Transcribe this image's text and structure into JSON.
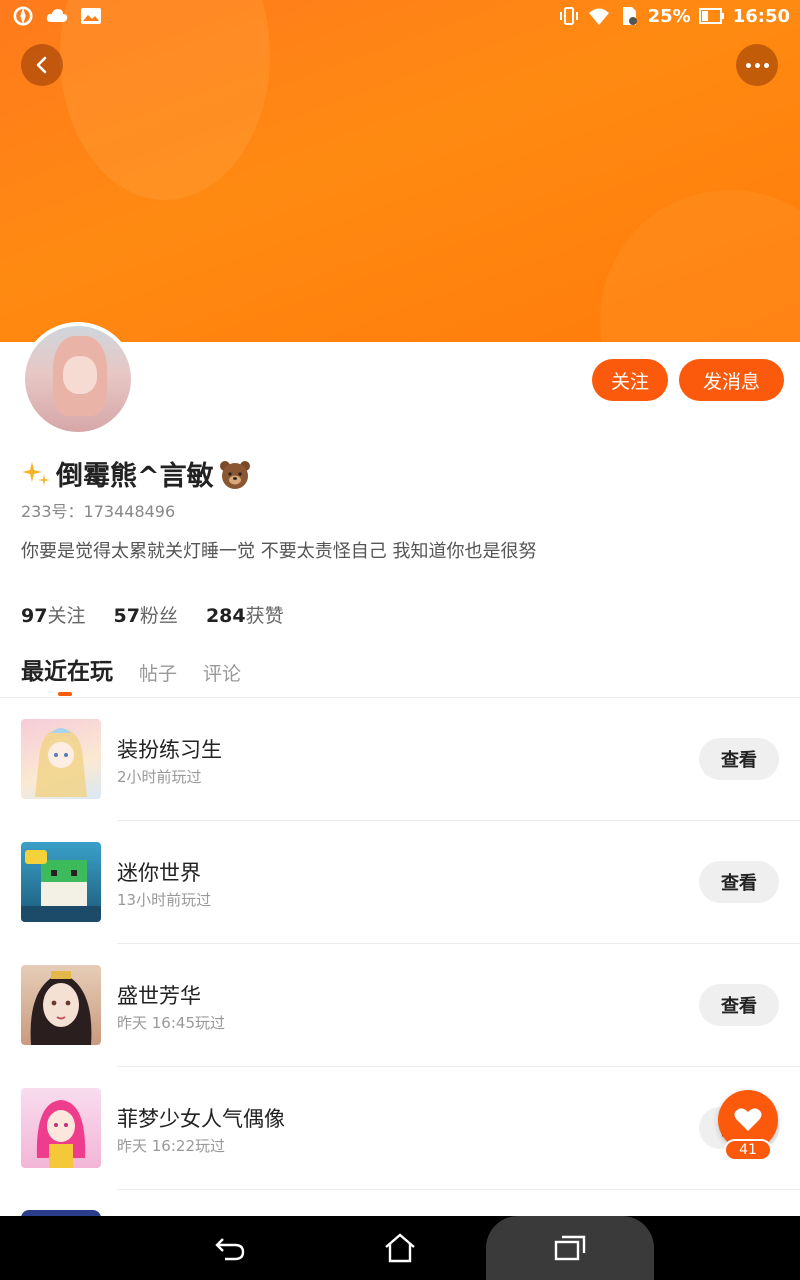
{
  "status_bar": {
    "battery": "25%",
    "time": "16:50"
  },
  "header": {
    "back_icon": "chevron-left-icon",
    "more_icon": "more-dots-icon",
    "banner_color": "#ff8112"
  },
  "profile": {
    "follow_label": "关注",
    "message_label": "发消息",
    "nickname": "倒霉熊^言敏",
    "uid": "233号：173448496",
    "bio": "你要是觉得太累就关灯睡一觉 不要太责怪自己 我知道你也是很努",
    "stats": [
      {
        "count": "97",
        "label": "关注"
      },
      {
        "count": "57",
        "label": "粉丝"
      },
      {
        "count": "284",
        "label": "获赞"
      }
    ]
  },
  "tabs": [
    {
      "label": "最近在玩",
      "active": true
    },
    {
      "label": "帖子",
      "active": false
    },
    {
      "label": "评论",
      "active": false
    }
  ],
  "games": [
    {
      "title": "装扮练习生",
      "time": "2小时前玩过",
      "button": "查看",
      "thumb_color": "#f3c9d6"
    },
    {
      "title": "迷你世界",
      "time": "13小时前玩过",
      "button": "查看",
      "thumb_color": "#2f8a6a"
    },
    {
      "title": "盛世芳华",
      "time": "昨天 16:45玩过",
      "button": "查看",
      "thumb_color": "#d9b9a8"
    },
    {
      "title": "菲梦少女人气偶像",
      "time": "昨天 16:22玩过",
      "button": "查看",
      "thumb_color": "#f7d3e8"
    }
  ],
  "fab": {
    "icon": "heart-icon",
    "count": "41"
  },
  "colors": {
    "accent": "#fb5a0c"
  }
}
